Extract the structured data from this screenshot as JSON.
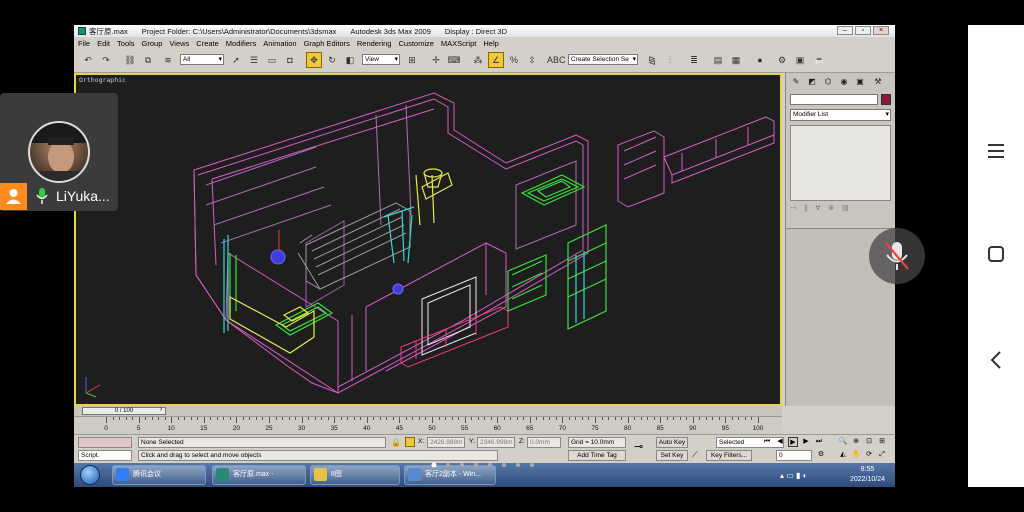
{
  "window": {
    "title": "客厅原.max",
    "project_folder": "Project Folder: C:\\Users\\Administrator\\Documents\\3dsmax",
    "app_name": "Autodesk 3ds Max  2009",
    "display": "Display : Direct 3D"
  },
  "menu": [
    "File",
    "Edit",
    "Tools",
    "Group",
    "Views",
    "Create",
    "Modifiers",
    "Animation",
    "Graph Editors",
    "Rendering",
    "Customize",
    "MAXScript",
    "Help"
  ],
  "toolbar": {
    "selection_filter": "All",
    "reference_coord": "View",
    "named_selection": "Create Selection Se"
  },
  "viewport": {
    "label": "Orthographic"
  },
  "command_panel": {
    "modifier_list": "Modifier List"
  },
  "timeline": {
    "frame_counter": "0 / 100",
    "ticks": [
      "0",
      "5",
      "10",
      "15",
      "20",
      "25",
      "30",
      "35",
      "40",
      "45",
      "50",
      "55",
      "60",
      "65",
      "70",
      "75",
      "80",
      "85",
      "90",
      "95",
      "100"
    ]
  },
  "status": {
    "script_label": "Script.",
    "selection_status": "None Selected",
    "prompt": "Click and drag to select and move objects",
    "x_label": "X:",
    "x_value": "2426.988m",
    "y_label": "Y:",
    "y_value": "2346.998m",
    "z_label": "Z:",
    "z_value": "0.0mm",
    "grid": "Grid = 10.0mm",
    "add_time_tag": "Add Time Tag",
    "auto_key": "Auto Key",
    "set_key": "Set Key",
    "key_mode": "Selected",
    "key_filters": "Key Filters...",
    "current_frame": "0"
  },
  "taskbar": {
    "tasks": [
      "腾讯会议",
      "客厅原.max -",
      "8图",
      "客厅2副本 - Win..."
    ],
    "clock_time": "8:55",
    "clock_date": "2022/10/24"
  },
  "meeting": {
    "participant_name": "LiYuka..."
  },
  "colors": {
    "viewport_bg": "#1e1e1e",
    "viewport_border": "#e8d44a",
    "wire_magenta": "#d65cc8",
    "wire_green": "#37e33a",
    "wire_yellow": "#e8e84a",
    "wire_cyan": "#3ad6d6",
    "taskbar": "#2d4c7c",
    "host_badge": "#ff8a1e"
  }
}
